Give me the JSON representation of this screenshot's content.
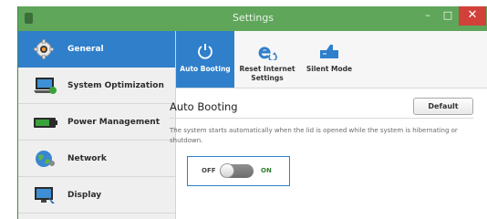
{
  "window": {
    "title": "Settings"
  },
  "titlebar_buttons": {
    "minimize": "–",
    "maximize": "□",
    "close": "✕"
  },
  "sidebar": {
    "items": [
      {
        "label": "General",
        "icon": "gear-icon",
        "active": true
      },
      {
        "label": "System Optimization",
        "icon": "laptop-icon",
        "active": false
      },
      {
        "label": "Power Management",
        "icon": "battery-icon",
        "active": false
      },
      {
        "label": "Network",
        "icon": "globe-icon",
        "active": false
      },
      {
        "label": "Display",
        "icon": "display-icon",
        "active": false
      }
    ]
  },
  "tabs": [
    {
      "label": "Auto Booting",
      "icon": "power-icon",
      "active": true
    },
    {
      "label": "Reset Internet Settings",
      "icon": "internet-reset-icon",
      "active": false
    },
    {
      "label": "Silent Mode",
      "icon": "silent-mode-icon",
      "active": false
    }
  ],
  "content": {
    "title": "Auto Booting",
    "default_button": "Default",
    "description": "The system starts automatically when the lid is opened while the system is hibernating or shutdown.",
    "toggle": {
      "off_label": "OFF",
      "on_label": "ON",
      "state": "off"
    }
  },
  "colors": {
    "titlebar": "#5fa65a",
    "accent": "#2f7fcb",
    "close": "#d2403a",
    "on_label": "#2f7d2f"
  }
}
